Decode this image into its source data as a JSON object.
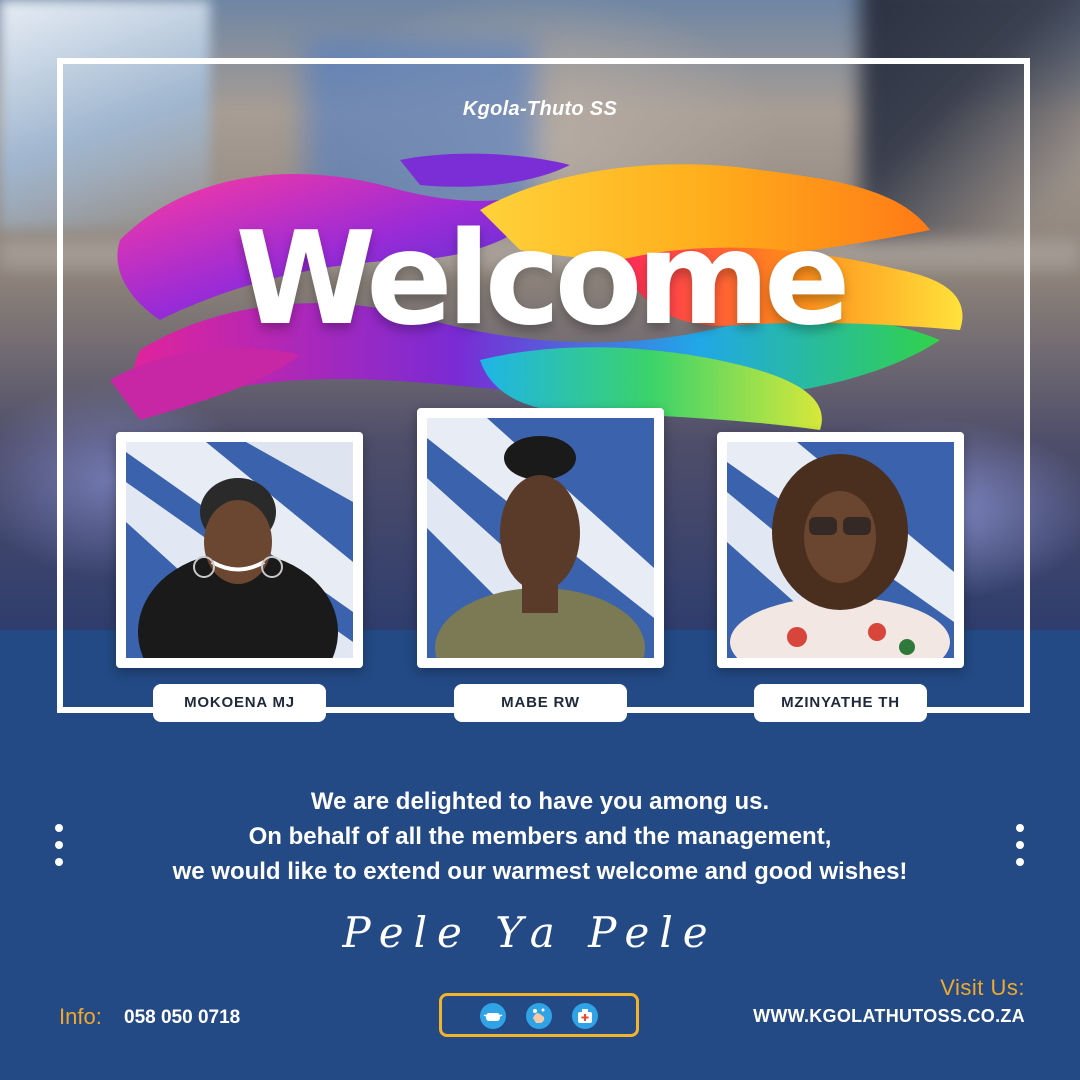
{
  "school": {
    "name": "Kgola-Thuto SS"
  },
  "banner": {
    "title": "Welcome"
  },
  "staff": [
    {
      "name": "MOKOENA MJ"
    },
    {
      "name": "MABE RW"
    },
    {
      "name": "MZINYATHE TH"
    }
  ],
  "message": {
    "line1": "We are delighted to have you among us.",
    "line2": "On behalf of all the members and the management,",
    "line3": "we would like to extend our warmest welcome and good wishes!"
  },
  "motto": "Pele Ya Pele",
  "contact": {
    "info_label": "Info:",
    "phone": "058 050 0718",
    "visit_label": "Visit Us:",
    "website": "WWW.KGOLATHUTOSS.CO.ZA"
  },
  "icons": [
    "mask-icon",
    "hand-wash-icon",
    "first-aid-icon"
  ],
  "colors": {
    "primary_blue": "#234a85",
    "accent_gold": "#f1a92b",
    "icon_blue": "#2fa3e6",
    "white": "#ffffff"
  }
}
